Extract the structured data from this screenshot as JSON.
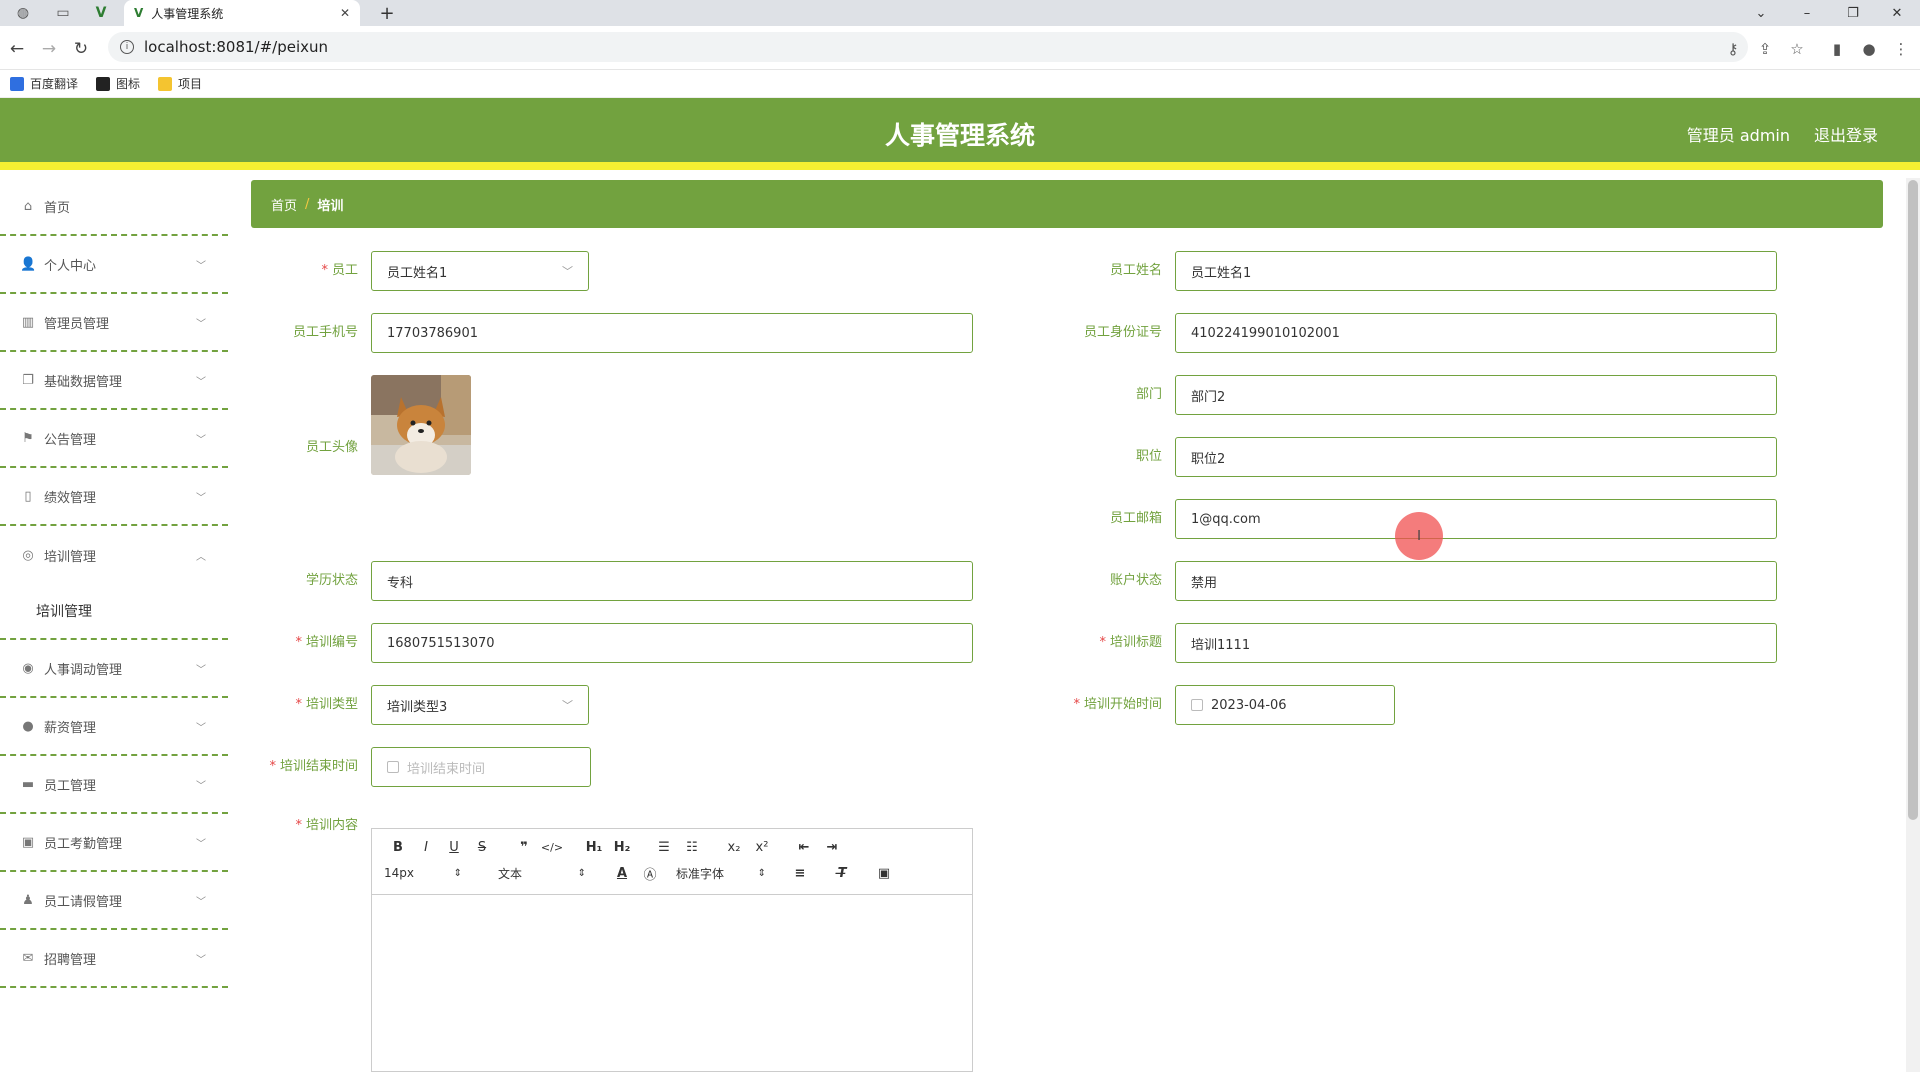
{
  "browser": {
    "tab_title": "人事管理系统",
    "url": "localhost:8081/#/peixun",
    "bookmarks": [
      "百度翻译",
      "图标",
      "项目"
    ]
  },
  "header": {
    "title": "人事管理系统",
    "admin": "管理员 admin",
    "logout": "退出登录"
  },
  "sidebar": {
    "items": [
      {
        "label": "首页",
        "icon": "home-icon"
      },
      {
        "label": "个人中心",
        "icon": "user-icon"
      },
      {
        "label": "管理员管理",
        "icon": "chart-icon"
      },
      {
        "label": "基础数据管理",
        "icon": "copy-icon"
      },
      {
        "label": "公告管理",
        "icon": "flag-icon"
      },
      {
        "label": "绩效管理",
        "icon": "bottle-icon"
      },
      {
        "label": "培训管理",
        "icon": "globe-icon"
      },
      {
        "label": "人事调动管理",
        "icon": "target-icon"
      },
      {
        "label": "薪资管理",
        "icon": "balloon-icon"
      },
      {
        "label": "员工管理",
        "icon": "ticket-icon"
      },
      {
        "label": "员工考勤管理",
        "icon": "clipboard-icon"
      },
      {
        "label": "员工请假管理",
        "icon": "person-icon"
      },
      {
        "label": "招聘管理",
        "icon": "mail-icon"
      }
    ],
    "submenu_active": "培训管理"
  },
  "breadcrumb": {
    "home": "首页",
    "separator": "/",
    "current": "培训"
  },
  "form": {
    "employee": {
      "label": "员工",
      "value": "员工姓名1"
    },
    "employee_name": {
      "label": "员工姓名",
      "value": "员工姓名1"
    },
    "phone": {
      "label": "员工手机号",
      "value": "17703786901"
    },
    "id_card": {
      "label": "员工身份证号",
      "value": "410224199010102001"
    },
    "department": {
      "label": "部门",
      "value": "部门2"
    },
    "position": {
      "label": "职位",
      "value": "职位2"
    },
    "avatar": {
      "label": "员工头像"
    },
    "email": {
      "label": "员工邮箱",
      "value": "1@qq.com"
    },
    "education": {
      "label": "学历状态",
      "value": "专科"
    },
    "account_status": {
      "label": "账户状态",
      "value": "禁用"
    },
    "training_no": {
      "label": "培训编号",
      "value": "1680751513070"
    },
    "training_title": {
      "label": "培训标题",
      "value": "培训1111"
    },
    "training_type": {
      "label": "培训类型",
      "value": "培训类型3"
    },
    "start_time": {
      "label": "培训开始时间",
      "value": "2023-04-06"
    },
    "end_time": {
      "label": "培训结束时间",
      "placeholder": "培训结束时间"
    },
    "content": {
      "label": "培训内容"
    }
  },
  "editor": {
    "font_size": "14px",
    "block_format": "文本",
    "font_family": "标准字体"
  },
  "colors": {
    "primary": "#72a23f",
    "accent_bar": "#f5f032",
    "required": "#e54545"
  }
}
